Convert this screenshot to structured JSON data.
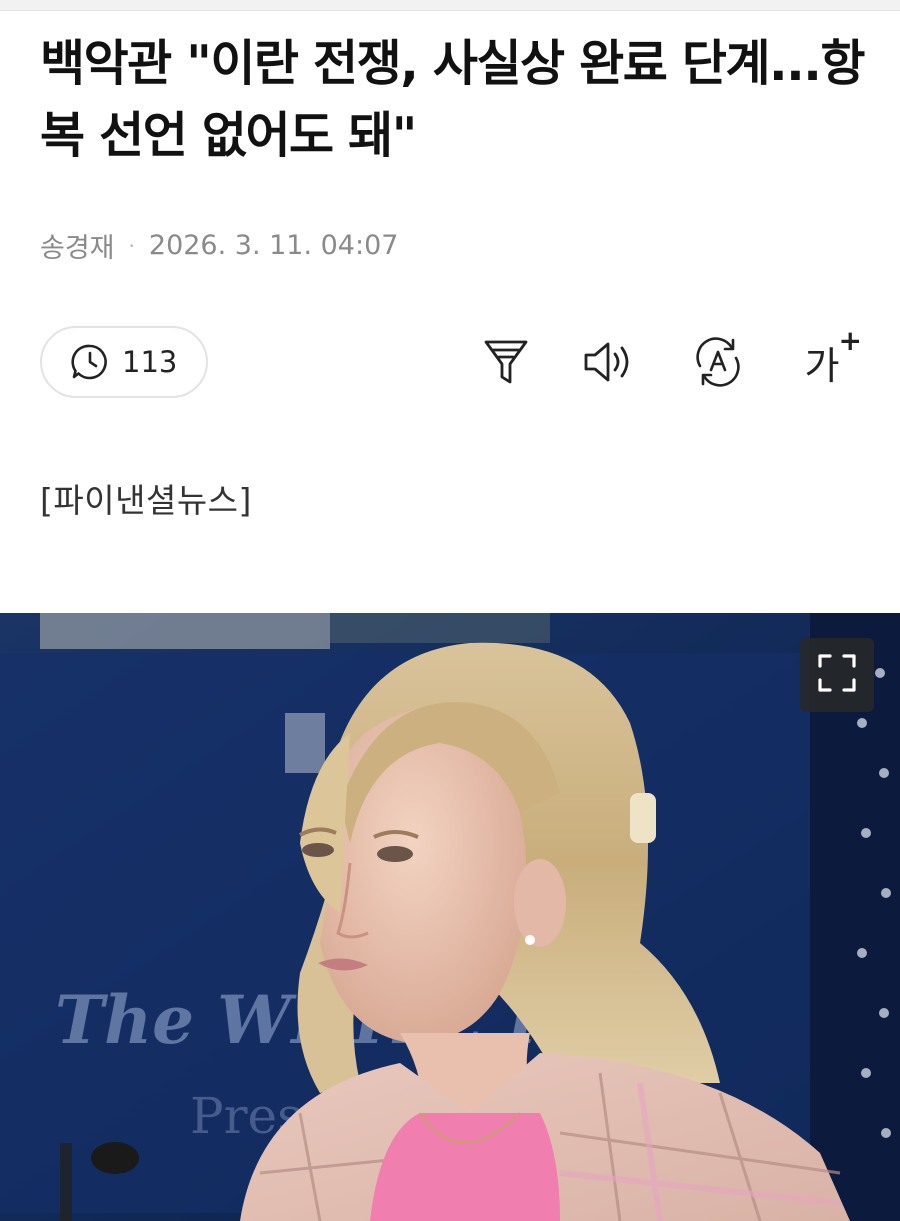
{
  "article": {
    "headline": "백악관 \"이란 전쟁, 사실상 완료 단계...항복 선언 없어도 돼\"",
    "author": "송경재",
    "separator": "·",
    "date": "2026. 3. 11. 04:07",
    "source": "[파이낸셜뉴스]"
  },
  "toolbar": {
    "comment_count": "113",
    "comment_icon": "comment-clock-icon",
    "summary_icon": "filter-funnel-icon",
    "listen_icon": "speaker-icon",
    "translate_icon": "translate-a-icon",
    "font_size_label": "가",
    "font_size_plus": "+"
  },
  "photo": {
    "backdrop_text_line1": "The WHITE H",
    "backdrop_text_line2": "Press Brie",
    "expand_icon": "fullscreen-expand-icon"
  },
  "colors": {
    "background": "#ffffff",
    "meta_gray": "#8a8a8a",
    "pill_border": "#e3e3e3",
    "photo_backdrop": "#0f2752"
  }
}
